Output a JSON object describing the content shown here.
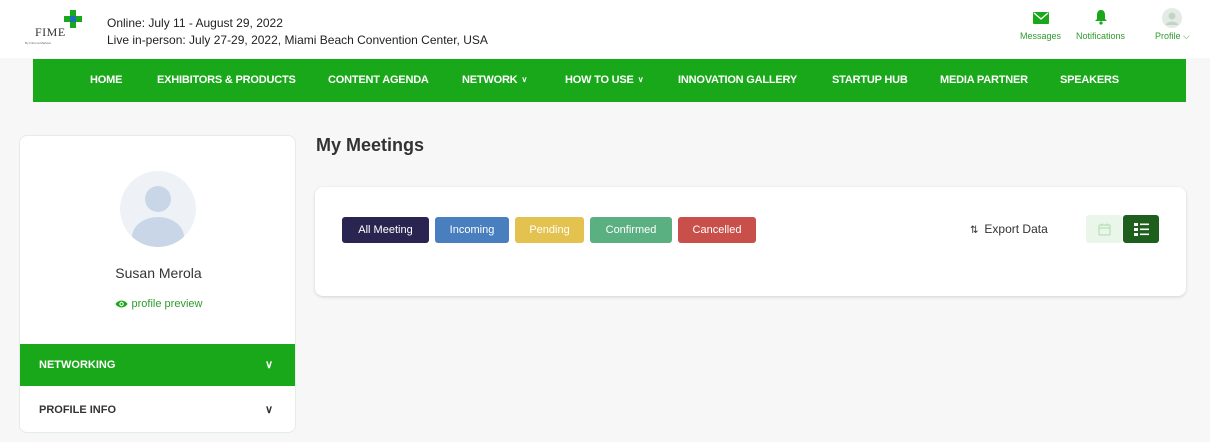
{
  "header": {
    "logo_text": "FIME",
    "logo_subtext": "By Informa Markets",
    "online_dates": "Online: July 11 - August 29, 2022",
    "inperson_dates": "Live in-person: July 27-29, 2022, Miami Beach Convention Center, USA",
    "messages_label": "Messages",
    "notifications_label": "Notifications",
    "profile_label": "Profile",
    "accent_color": "#19a819"
  },
  "nav": {
    "items": [
      {
        "label": "HOME"
      },
      {
        "label": "EXHIBITORS & PRODUCTS"
      },
      {
        "label": "CONTENT AGENDA"
      },
      {
        "label": "NETWORK",
        "dropdown": true
      },
      {
        "label": "HOW TO USE",
        "dropdown": true
      },
      {
        "label": "INNOVATION GALLERY"
      },
      {
        "label": "STARTUP HUB"
      },
      {
        "label": "MEDIA PARTNER"
      },
      {
        "label": "SPEAKERS"
      }
    ]
  },
  "sidebar": {
    "user_name": "Susan Merola",
    "profile_preview_label": "profile preview",
    "items": [
      {
        "label": "NETWORKING",
        "active": true
      },
      {
        "label": "PROFILE INFO",
        "active": false
      }
    ]
  },
  "main": {
    "title": "My Meetings",
    "filters": [
      {
        "label": "All Meeting",
        "color": "#2a2550"
      },
      {
        "label": "Incoming",
        "color": "#4a7fbf"
      },
      {
        "label": "Pending",
        "color": "#e3c24f"
      },
      {
        "label": "Confirmed",
        "color": "#5bb082"
      },
      {
        "label": "Cancelled",
        "color": "#c9504a"
      }
    ],
    "export_label": "Export Data",
    "view_modes": [
      "calendar-icon",
      "list-icon"
    ],
    "active_view": "list"
  }
}
